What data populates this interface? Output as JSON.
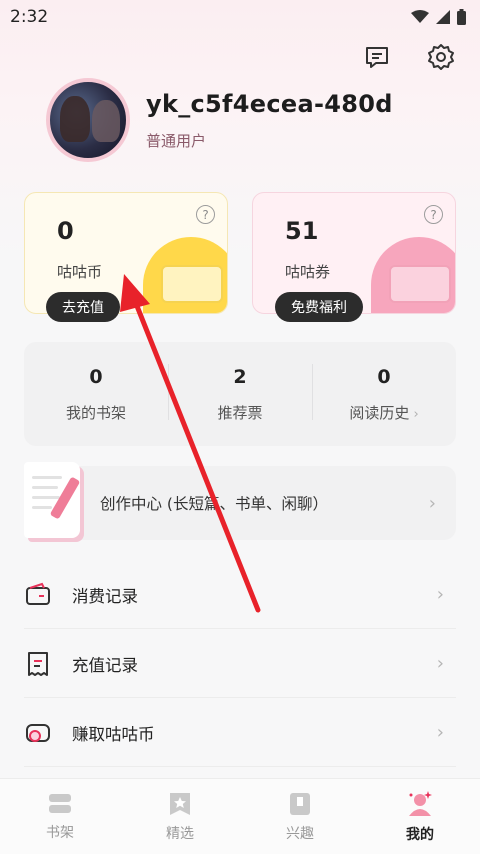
{
  "status_bar": {
    "time": "2:32"
  },
  "top_icons": {
    "message": "message-icon",
    "settings": "gear-icon"
  },
  "profile": {
    "username": "yk_c5f4ecea-480d",
    "user_type": "普通用户"
  },
  "wallet": {
    "coins": {
      "value": "0",
      "label": "咕咕币",
      "button": "去充值"
    },
    "coupons": {
      "value": "51",
      "label": "咕咕券",
      "button": "免费福利"
    }
  },
  "stats": [
    {
      "value": "0",
      "label": "我的书架"
    },
    {
      "value": "2",
      "label": "推荐票"
    },
    {
      "value": "0",
      "label": "阅读历史"
    }
  ],
  "create_center": {
    "label": "创作中心 (长短篇、书单、闲聊）"
  },
  "menu": [
    {
      "label": "消费记录",
      "icon": "wallet-icon"
    },
    {
      "label": "充值记录",
      "icon": "receipt-icon"
    },
    {
      "label": "赚取咕咕币",
      "icon": "coin-earn-icon"
    }
  ],
  "tabs": [
    {
      "label": "书架",
      "icon": "bookshelf-icon",
      "active": false
    },
    {
      "label": "精选",
      "icon": "featured-icon",
      "active": false
    },
    {
      "label": "兴趣",
      "icon": "interest-icon",
      "active": false
    },
    {
      "label": "我的",
      "icon": "profile-icon",
      "active": true
    }
  ],
  "colors": {
    "accent": "#e8325a",
    "annotation_arrow": "#e8222a"
  }
}
